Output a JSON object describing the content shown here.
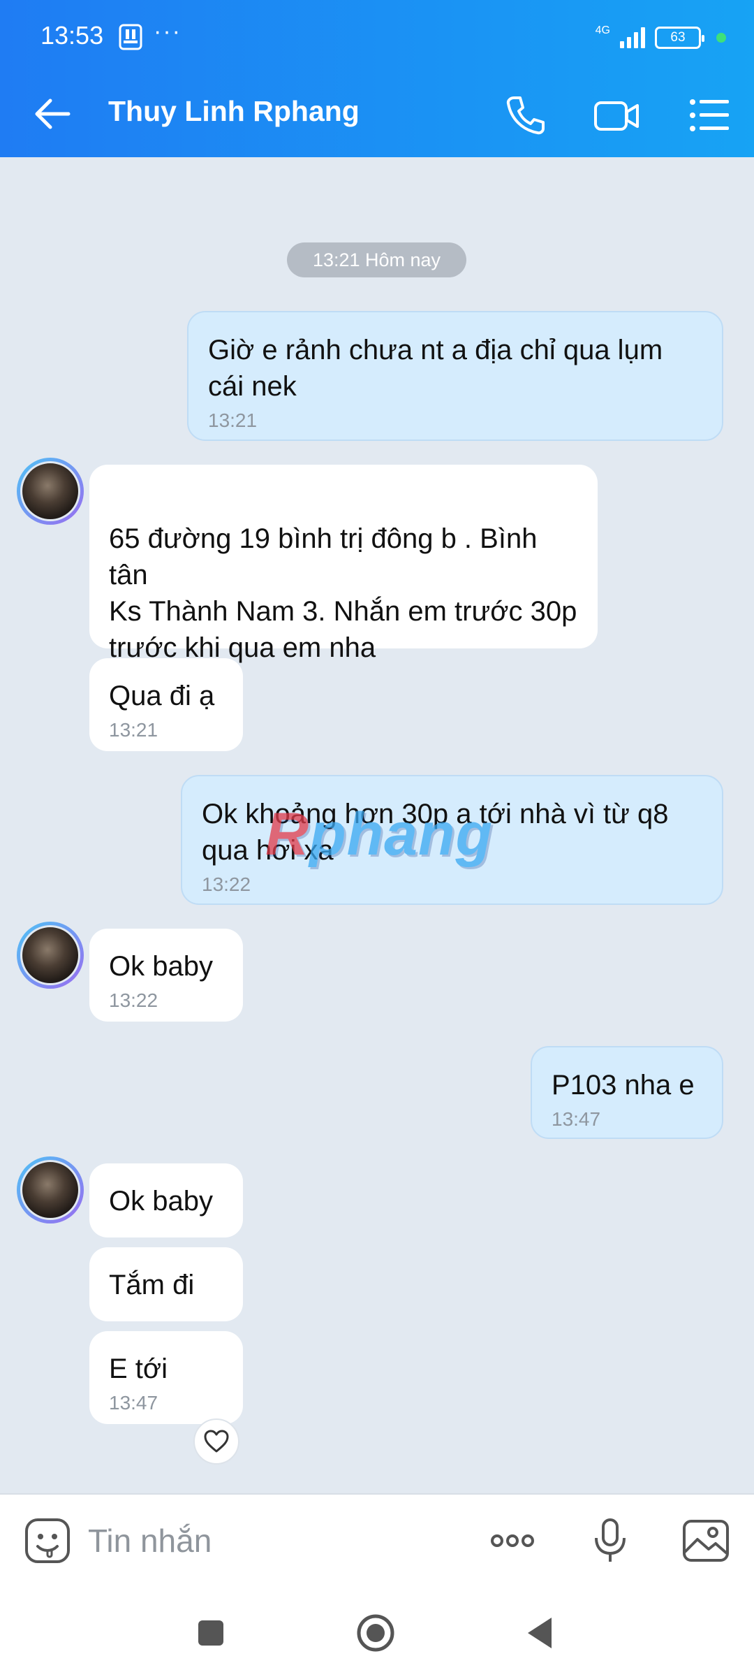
{
  "status_bar": {
    "time": "13:53",
    "dots": "···",
    "network": "4G",
    "battery": "63",
    "signal_levels": [
      1,
      2,
      3,
      4
    ]
  },
  "header": {
    "contact_name": "Thuy Linh Rphang",
    "icons": [
      "back-arrow-icon",
      "phone-icon",
      "video-call-icon",
      "menu-list-icon"
    ]
  },
  "chat": {
    "date_chip": "13:21 Hôm nay",
    "messages": [
      {
        "dir": "out",
        "text": "Giờ e rảnh chưa nt a địa chỉ qua lụm cái nek",
        "time": "13:21"
      },
      {
        "dir": "in",
        "text": "65 đường 19 bình trị đông b . Bình tân\nKs Thành Nam 3. Nhắn em trước 30p trước khi qua em nha",
        "time": ""
      },
      {
        "dir": "in",
        "text": "Qua đi ạ",
        "time": "13:21"
      },
      {
        "dir": "out",
        "text": "Ok khoảng hơn 30p a tới nhà vì từ q8 qua hơi xa",
        "time": "13:22"
      },
      {
        "dir": "in",
        "text": "Ok baby",
        "time": "13:22"
      },
      {
        "dir": "out",
        "text": "P103 nha e",
        "time": "13:47"
      },
      {
        "dir": "in",
        "text": "Ok baby",
        "time": ""
      },
      {
        "dir": "in",
        "text": "Tắm đi",
        "time": ""
      },
      {
        "dir": "in",
        "text": "E tới",
        "time": "13:47"
      }
    ],
    "watermark_r": "R",
    "watermark_rest": "phang"
  },
  "input_bar": {
    "placeholder": "Tin nhắn",
    "icons": [
      "sticker-icon",
      "more-options-icon",
      "microphone-icon",
      "gallery-icon"
    ]
  },
  "colors": {
    "header_start": "#1f7cf3",
    "header_end": "#17a3f4",
    "outgoing_bubble": "#d5ecfd",
    "incoming_bubble": "#ffffff",
    "chat_background": "#e2e9f1"
  }
}
